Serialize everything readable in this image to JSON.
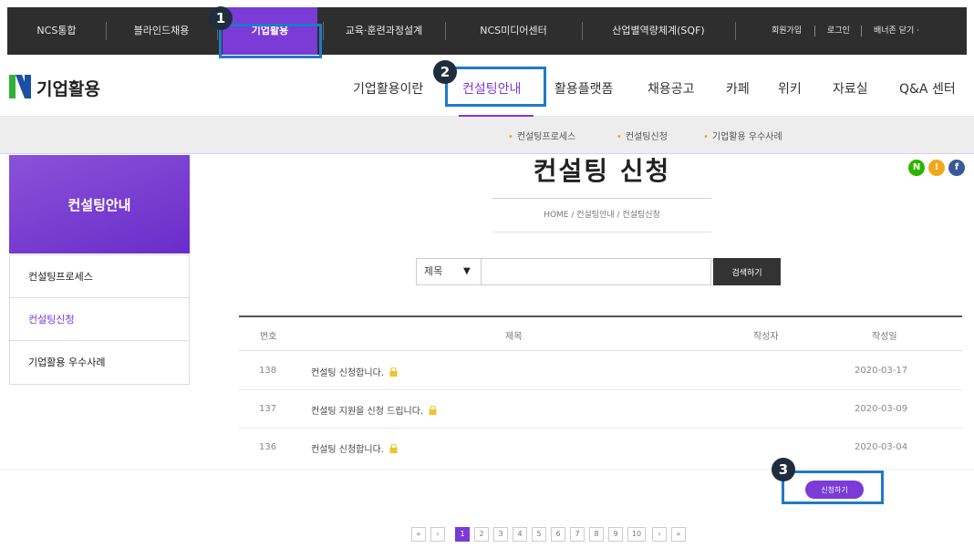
{
  "topbar": {
    "items": [
      "NCS통합",
      "블라인드채용",
      "기업활용",
      "교육·훈련과정설계",
      "NCS미디어센터",
      "산업별역량체계(SQF)"
    ],
    "util": [
      "회원가입",
      "로그인",
      "배너존 닫기 ·"
    ]
  },
  "header": {
    "logo_letter": "N",
    "logo_text": "기업활용",
    "nav": [
      "기업활용이란",
      "컨설팅안내",
      "활용플랫폼",
      "채용공고",
      "카페",
      "위키",
      "자료실",
      "Q&A 센터"
    ]
  },
  "subnav": {
    "items": [
      "컨설팅프로세스",
      "컨설팅신청",
      "기업활용 우수사례"
    ]
  },
  "sidebar": {
    "title": "컨설팅안내",
    "items": [
      "컨설팅프로세스",
      "컨설팅신청",
      "기업활용 우수사례"
    ]
  },
  "page": {
    "title": "컨설팅 신청",
    "breadcrumb": "HOME / 컨설팅안내 / 컨설팅신청"
  },
  "sns": [
    "N",
    "!",
    "f"
  ],
  "search": {
    "select_value": "제목",
    "input_value": "",
    "button_label": "검색하기"
  },
  "table": {
    "headers": [
      "번호",
      "제목",
      "작성자",
      "작성일"
    ],
    "rows": [
      {
        "num": "138",
        "title": "컨설팅 신청합니다.",
        "author": "",
        "date": "2020-03-17"
      },
      {
        "num": "137",
        "title": "컨설팅 지원을 신청 드립니다.",
        "author": "",
        "date": "2020-03-09"
      },
      {
        "num": "136",
        "title": "컨설팅 신청합니다.",
        "author": "",
        "date": "2020-03-04"
      }
    ]
  },
  "apply_button": "신청하기",
  "pagination": {
    "first": "«",
    "prev": "‹",
    "pages": [
      "1",
      "2",
      "3",
      "4",
      "5",
      "6",
      "7",
      "8",
      "9",
      "10"
    ],
    "next": "›",
    "last": "»",
    "current": "1"
  },
  "callouts": [
    "1",
    "2",
    "3"
  ],
  "colors": {
    "accent": "#7a3bd6",
    "callout_box": "#1f7ac9",
    "topbar": "#2e2e2e",
    "sns_green": "#2db400",
    "sns_yellow": "#f2a81e",
    "sns_blue": "#3b5998"
  }
}
